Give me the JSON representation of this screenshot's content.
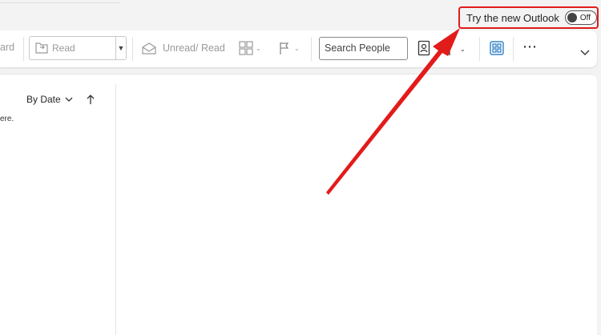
{
  "topbar": {
    "try_new_label": "Try the new Outlook",
    "toggle_state": "Off"
  },
  "ribbon": {
    "forward_partial": "ard",
    "move_label": "Read",
    "unread_read_label": "Unread/ Read",
    "search_placeholder": "Search People"
  },
  "mail_list": {
    "sort_label": "By Date",
    "empty_snippet": "ere."
  },
  "colors": {
    "highlight": "#e21b1b",
    "accent": "#0f6cbd"
  }
}
